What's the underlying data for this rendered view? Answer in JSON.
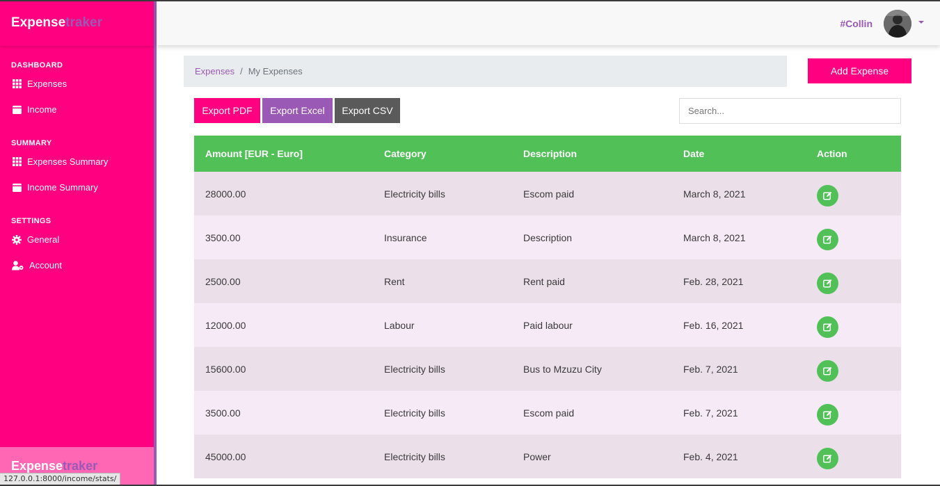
{
  "sidebar": {
    "brand_part1": "Expense",
    "brand_part2": "traker",
    "sections": [
      {
        "title": "DASHBOARD",
        "items": [
          {
            "label": "Expenses",
            "icon": "grid-icon"
          },
          {
            "label": "Income",
            "icon": "wallet-icon"
          }
        ]
      },
      {
        "title": "SUMMARY",
        "items": [
          {
            "label": "Expenses Summary",
            "icon": "grid-icon"
          },
          {
            "label": "Income Summary",
            "icon": "wallet-icon"
          }
        ]
      },
      {
        "title": "SETTINGS",
        "items": [
          {
            "label": "General",
            "icon": "gear-icon"
          },
          {
            "label": "Account",
            "icon": "user-cog-icon"
          }
        ]
      }
    ],
    "footer_part1": "Expense",
    "footer_part2": "traker"
  },
  "status_url": "127.0.0.1:8000/income/stats/",
  "topbar": {
    "username": "#Collin"
  },
  "breadcrumb": {
    "link": "Expenses",
    "separator": "/",
    "active": "My Expenses"
  },
  "actions": {
    "add_expense": "Add Expense",
    "export_pdf": "Export PDF",
    "export_excel": "Export Excel",
    "export_csv": "Export CSV",
    "search_placeholder": "Search..."
  },
  "table": {
    "headers": [
      "Amount [EUR - Euro]",
      "Category",
      "Description",
      "Date",
      "Action"
    ],
    "rows": [
      {
        "amount": "28000.00",
        "category": "Electricity bills",
        "description": "Escom paid",
        "date": "March 8, 2021"
      },
      {
        "amount": "3500.00",
        "category": "Insurance",
        "description": "Description",
        "date": "March 8, 2021"
      },
      {
        "amount": "2500.00",
        "category": "Rent",
        "description": "Rent paid",
        "date": "Feb. 28, 2021"
      },
      {
        "amount": "12000.00",
        "category": "Labour",
        "description": "Paid labour",
        "date": "Feb. 16, 2021"
      },
      {
        "amount": "15600.00",
        "category": "Electricity bills",
        "description": "Bus to Mzuzu City",
        "date": "Feb. 7, 2021"
      },
      {
        "amount": "3500.00",
        "category": "Electricity bills",
        "description": "Escom paid",
        "date": "Feb. 7, 2021"
      },
      {
        "amount": "45000.00",
        "category": "Electricity bills",
        "description": "Power",
        "date": "Feb. 4, 2021"
      }
    ]
  },
  "colors": {
    "primary": "#ff0080",
    "secondary": "#9b59b6",
    "success": "#51c157",
    "dark": "#5a5a5a"
  }
}
